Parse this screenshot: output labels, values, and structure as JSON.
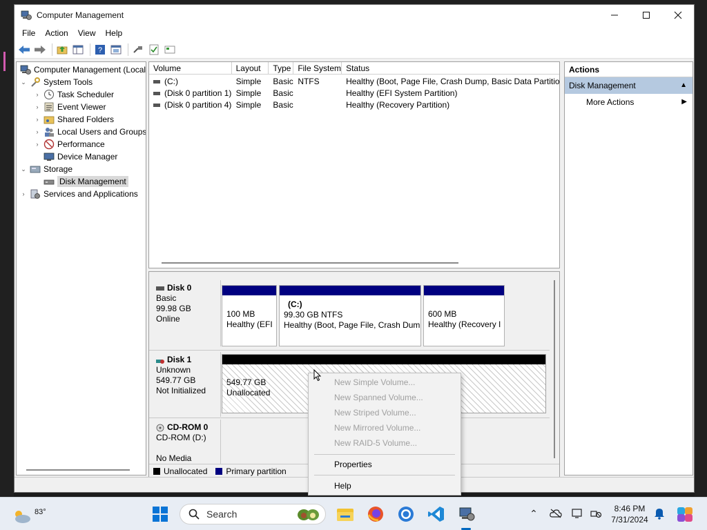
{
  "window": {
    "title": "Computer Management",
    "minimize_icon": "minimize-icon",
    "maximize_icon": "maximize-icon",
    "close_icon": "close-icon"
  },
  "menu": [
    "File",
    "Action",
    "View",
    "Help"
  ],
  "toolbar_icons": [
    "back-arrow-icon",
    "forward-arrow-icon",
    "up-folder-icon",
    "show-hide-tree-icon",
    "help-icon",
    "properties-icon",
    "connect-icon",
    "checklist-icon",
    "console-icon"
  ],
  "tree": {
    "root": "Computer Management (Local",
    "system_tools": "System Tools",
    "task_scheduler": "Task Scheduler",
    "event_viewer": "Event Viewer",
    "shared_folders": "Shared Folders",
    "local_users": "Local Users and Groups",
    "performance": "Performance",
    "device_manager": "Device Manager",
    "storage": "Storage",
    "disk_management": "Disk Management",
    "services_apps": "Services and Applications"
  },
  "volume_list": {
    "columns": [
      "Volume",
      "Layout",
      "Type",
      "File System",
      "Status"
    ],
    "rows": [
      [
        "(C:)",
        "Simple",
        "Basic",
        "NTFS",
        "Healthy (Boot, Page File, Crash Dump, Basic Data Partition)"
      ],
      [
        "(Disk 0 partition 1)",
        "Simple",
        "Basic",
        "",
        "Healthy (EFI System Partition)"
      ],
      [
        "(Disk 0 partition 4)",
        "Simple",
        "Basic",
        "",
        "Healthy (Recovery Partition)"
      ]
    ]
  },
  "disks": {
    "disk0": {
      "name": "Disk 0",
      "type": "Basic",
      "size": "99.98 GB",
      "status": "Online",
      "partitions": [
        {
          "label": "",
          "size": "100 MB",
          "status": "Healthy (EFI"
        },
        {
          "label": "(C:)",
          "size": "99.30 GB NTFS",
          "status": "Healthy (Boot, Page File, Crash Dum|"
        },
        {
          "label": "",
          "size": "600 MB",
          "status": "Healthy (Recovery I"
        }
      ]
    },
    "disk1": {
      "name": "Disk 1",
      "type": "Unknown",
      "size": "549.77 GB",
      "status": "Not Initialized",
      "unallocated_size": "549.77 GB",
      "unallocated_label": "Unallocated"
    },
    "cdrom0": {
      "name": "CD-ROM 0",
      "type": "CD-ROM (D:)",
      "status": "No Media"
    }
  },
  "legend": {
    "unallocated": "Unallocated",
    "primary": "Primary partition",
    "unallocated_color": "#000000",
    "primary_color": "#000080"
  },
  "actions": {
    "header": "Actions",
    "section": "Disk Management",
    "more": "More Actions"
  },
  "context_menu": {
    "new_simple": "New Simple Volume...",
    "new_spanned": "New Spanned Volume...",
    "new_striped": "New Striped Volume...",
    "new_mirrored": "New Mirrored Volume...",
    "new_raid5": "New RAID-5 Volume...",
    "properties": "Properties",
    "help": "Help"
  },
  "taskbar": {
    "temperature": "83°",
    "search_label": "Search",
    "time": "8:46 PM",
    "date": "7/31/2024",
    "accent": "#0067c0"
  }
}
